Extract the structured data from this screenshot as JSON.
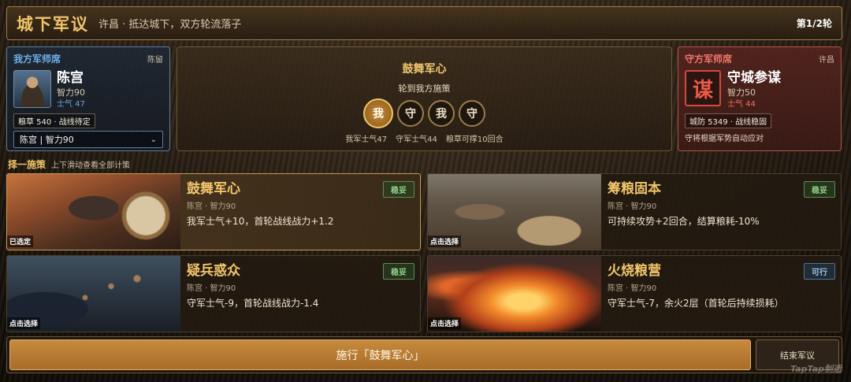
{
  "header": {
    "title": "城下军议",
    "subtitle": "许昌 · 抵达城下，双方轮流落子",
    "round": "第1/2轮"
  },
  "our_panel": {
    "heading": "我方军师席",
    "city": "陈留",
    "general_name": "陈宫",
    "intellect": "智力90",
    "morale": "士气 47",
    "resources": "粮草 540 · 战线待定",
    "selected_advisor": "陈宫 | 智力90",
    "portrait_icon": "advisor-portrait"
  },
  "enemy_panel": {
    "heading": "守方军师席",
    "city": "许昌",
    "seal_char": "谋",
    "general_name": "守城参谋",
    "intellect": "智力50",
    "morale": "士气 44",
    "resources": "城防 5349 · 战线稳固",
    "note": "守将根据军势自动应对"
  },
  "center": {
    "title": "鼓舞军心",
    "turn_text": "轮到我方施策",
    "tokens": [
      "我",
      "守",
      "我",
      "守"
    ],
    "stats": [
      "我军士气47",
      "守军士气44",
      "粮草可撑10回合"
    ]
  },
  "section": {
    "title": "择一施策",
    "hint": "上下滑动查看全部计策"
  },
  "cards": [
    {
      "name": "鼓舞军心",
      "source": "陈宫 · 智力90",
      "effect": "我军士气+10，首轮战线战力+1.2",
      "badge": "稳妥",
      "tag": "已选定"
    },
    {
      "name": "筹粮固本",
      "source": "陈宫 · 智力90",
      "effect": "可持续攻势+2回合，结算粮耗-10%",
      "badge": "稳妥",
      "tag": "点击选择"
    },
    {
      "name": "疑兵惑众",
      "source": "陈宫 · 智力90",
      "effect": "守军士气-9，首轮战线战力-1.4",
      "badge": "稳妥",
      "tag": "点击选择"
    },
    {
      "name": "火烧粮营",
      "source": "陈宫 · 智力90",
      "effect": "守军士气-7，余火2层（首轮后持续损耗）",
      "badge": "可行",
      "tag": "点击选择"
    }
  ],
  "actions": {
    "execute": "施行「鼓舞军心」",
    "end": "结束军议"
  },
  "watermark": "TapTap制造",
  "colors": {
    "accent_gold": "#f1c56a",
    "ally_blue": "#6fb0e8",
    "enemy_red": "#f0766a",
    "safe_green": "#8fd08a",
    "ok_blue": "#9ec3ea"
  }
}
